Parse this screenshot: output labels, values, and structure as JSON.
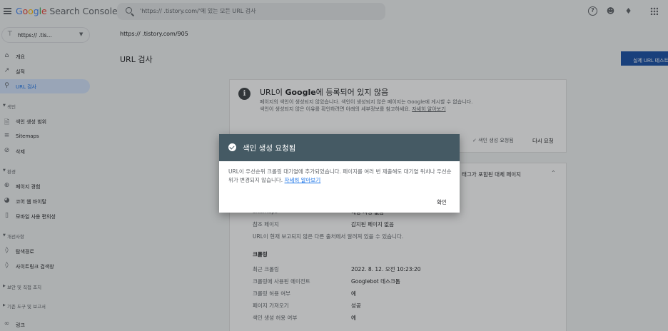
{
  "app": {
    "logo_google": "Google",
    "logo_product": "Search Console"
  },
  "search": {
    "text": "'https://              .tistory.com/'에 있는 모든 URL 검사"
  },
  "icons": {
    "menu": "menu-icon",
    "help": "help-icon",
    "users": "users-icon",
    "bell": "bell-icon",
    "apps": "apps-grid-icon"
  },
  "sidebar": {
    "property": "https://              .tis...",
    "items": [
      {
        "label": "개요",
        "icon": "home-icon"
      },
      {
        "label": "실적",
        "icon": "trend-icon"
      },
      {
        "label": "URL 검사",
        "icon": "search-icon",
        "selected": true
      }
    ],
    "index_section": "색인",
    "index_items": [
      {
        "label": "색인 생성 범위",
        "icon": "file-icon"
      },
      {
        "label": "Sitemaps",
        "icon": "sitemap-icon"
      },
      {
        "label": "삭제",
        "icon": "eye-off-icon"
      }
    ],
    "experience_section": "환경",
    "experience_items": [
      {
        "label": "페이지 경험",
        "icon": "plus-circle-icon"
      },
      {
        "label": "코어 웹 바이탈",
        "icon": "speed-icon"
      },
      {
        "label": "모바일 사용 편의성",
        "icon": "phone-icon"
      }
    ],
    "enhancements_section": "개선사항",
    "enhancements_items": [
      {
        "label": "탐색경로",
        "icon": "layers-icon"
      },
      {
        "label": "사이트링크 검색창",
        "icon": "layers-icon"
      }
    ],
    "security_section": "보안 및 직접 조치",
    "legacy_section": "기존 도구 및 보고서",
    "links_item": "링크"
  },
  "main": {
    "url": "https://              .tistory.com/905",
    "page_title": "URL 검사",
    "live_test_button": "실제 URL 테스트"
  },
  "status_card": {
    "title_prefix": "URL이 ",
    "title_brand": "Google",
    "title_suffix": "에 등록되어 있지 않음",
    "desc": "페이지의 색인이 생성되지 않았습니다. 색인이 생성되지 않은 페이지는 Google에 게시할 수 없습니다. 색인이 생성되지 않은 이유를 확인하려면 아래의 세부정보를 참고하세요. ",
    "desc_link": "자세히 알아보기",
    "requested_chip": "색인 생성 요청됨",
    "retry_button": "다시 요청"
  },
  "canonical_card": {
    "title": "태그가 포함된 대체 페이지",
    "rows": [
      {
        "label": "Sitemaps",
        "value": "해당 사항 없음"
      },
      {
        "label": "참조 페이지",
        "value": "감지된 페이지 없음"
      }
    ],
    "note": "URL이 현재 보고되지 않은 다른 출처에서 알려져 있을 수 있습니다.",
    "crawl_heading": "크롤링",
    "crawl_rows": [
      {
        "label": "최근 크롤링",
        "value": "2022. 8. 12. 오전 10:23:20"
      },
      {
        "label": "크롤링에 사용된 에이전트",
        "value": "Googlebot 데스크톱"
      },
      {
        "label": "크롤링 허용 여부",
        "value": "예"
      },
      {
        "label": "페이지 가져오기",
        "value": "성공"
      },
      {
        "label": "색인 생성 허용 여부",
        "value": "예"
      }
    ]
  },
  "dialog": {
    "title": "색인 생성 요청됨",
    "body": "URL이 우선순위 크롤링 대기열에 추가되었습니다. 페이지를 여러 번 제출해도 대기열 위치나 우선순위가 변경되지 않습니다. ",
    "body_link": "자세히 알아보기",
    "confirm": "확인"
  },
  "colors": {
    "dialog_header": "#455a64",
    "accent": "#1a73e8",
    "live_test_button": "#174ea6"
  }
}
